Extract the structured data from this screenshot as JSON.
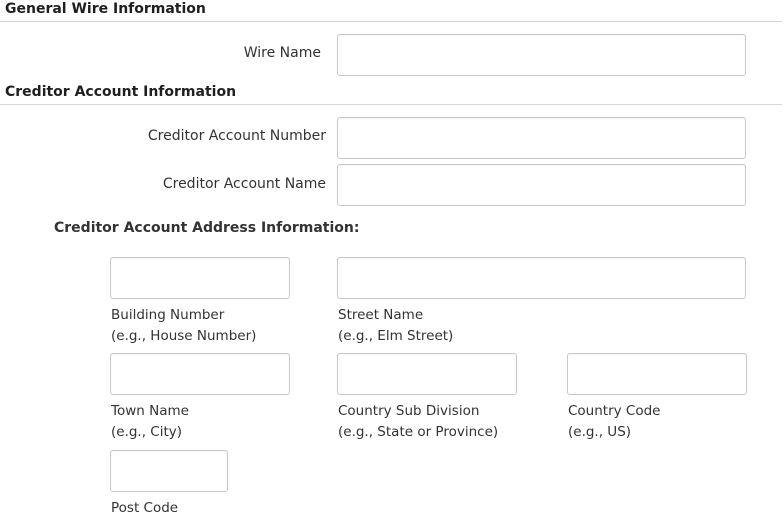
{
  "general": {
    "title": "General Wire Information",
    "wire_name_label": "Wire Name",
    "wire_name_value": ""
  },
  "creditor": {
    "title": "Creditor Account Information",
    "account_number_label": "Creditor Account Number",
    "account_number_value": "",
    "account_name_label": "Creditor Account Name",
    "account_name_value": "",
    "address_heading": "Creditor Account Address Information:",
    "address": {
      "building_number": {
        "label": "Building Number",
        "hint": "(e.g., House Number)",
        "value": ""
      },
      "street_name": {
        "label": "Street Name",
        "hint": "(e.g., Elm Street)",
        "value": ""
      },
      "town_name": {
        "label": "Town Name",
        "hint": "(e.g., City)",
        "value": ""
      },
      "country_sub_division": {
        "label": "Country Sub Division",
        "hint": "(e.g., State or Province)",
        "value": ""
      },
      "country_code": {
        "label": "Country Code",
        "hint": "(e.g., US)",
        "value": ""
      },
      "post_code": {
        "label": "Post Code",
        "value": ""
      }
    }
  }
}
